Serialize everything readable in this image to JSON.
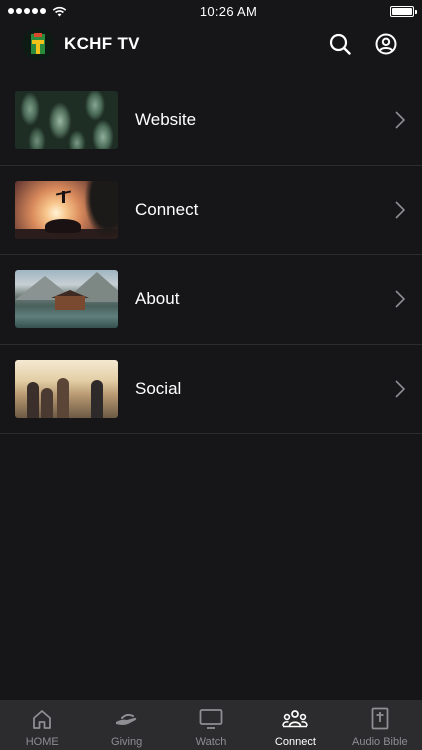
{
  "status_bar": {
    "time": "10:26 AM"
  },
  "header": {
    "title": "KCHF TV",
    "icons": [
      "search-icon",
      "account-icon"
    ]
  },
  "menu": {
    "items": [
      {
        "label": "Website",
        "thumbnail": "leaves"
      },
      {
        "label": "Connect",
        "thumbnail": "sunset"
      },
      {
        "label": "About",
        "thumbnail": "lake"
      },
      {
        "label": "Social",
        "thumbnail": "friends"
      }
    ]
  },
  "tabs": [
    {
      "label": "HOME",
      "icon": "home-icon",
      "active": false
    },
    {
      "label": "Giving",
      "icon": "giving-icon",
      "active": false
    },
    {
      "label": "Watch",
      "icon": "tv-icon",
      "active": false
    },
    {
      "label": "Connect",
      "icon": "group-icon",
      "active": true
    },
    {
      "label": "Audio Bible",
      "icon": "bible-icon",
      "active": false
    }
  ],
  "colors": {
    "background": "#161618",
    "tab_bar": "#2c2c2e",
    "divider": "#2c2c2e",
    "inactive_tab": "#8e8e93",
    "text": "#ffffff"
  }
}
